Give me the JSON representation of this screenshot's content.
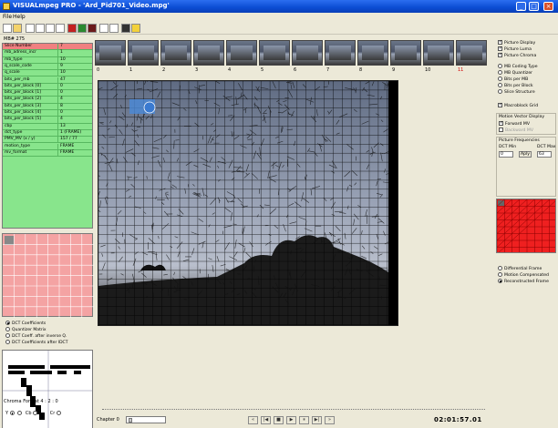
{
  "window": {
    "title": "VISUALmpeg PRO - 'Ard_Pid701_Video.mpg'"
  },
  "menu": {
    "file": "File",
    "help": "Help"
  },
  "toolbar": {
    "icons": [
      "new-icon",
      "open-icon",
      "frame-icon",
      "list-icon",
      "grid-icon",
      "grid2-icon",
      "stop-red-icon",
      "stop-green-icon",
      "stop-dark-icon",
      "zoom-icon",
      "target-icon",
      "monitor-icon",
      "warning-icon"
    ]
  },
  "slice_panel": {
    "mb_label": "MB# 275",
    "rows": [
      {
        "key": "Slice Number",
        "value": "7",
        "highlight": true
      },
      {
        "key": "mb_adress_incr",
        "value": "1"
      },
      {
        "key": "mb_type",
        "value": "10"
      },
      {
        "key": "q_scale_code",
        "value": "9"
      },
      {
        "key": "q_scale",
        "value": "10"
      },
      {
        "key": "bits_per_mb",
        "value": "47"
      },
      {
        "key": "bits_per_block [0]",
        "value": "0"
      },
      {
        "key": "bits_per_block [1]",
        "value": "0"
      },
      {
        "key": "bits_per_block [2]",
        "value": "4"
      },
      {
        "key": "bits_per_block [3]",
        "value": "8"
      },
      {
        "key": "bits_per_block [4]",
        "value": "0"
      },
      {
        "key": "bits_per_block [5]",
        "value": "4"
      },
      {
        "key": "cbp",
        "value": "13"
      },
      {
        "key": "dct_type",
        "value": "1 (FRAME)"
      },
      {
        "key": "PMV_MV (x / y)",
        "value": "157 / 77"
      },
      {
        "key": "motion_type",
        "value": "FRAME"
      },
      {
        "key": "mv_format",
        "value": "FRAME"
      }
    ]
  },
  "dct_view": {
    "options": [
      {
        "label": "DCT Coefficients",
        "selected": true
      },
      {
        "label": "Quantizer Matrix",
        "selected": false
      },
      {
        "label": "DCT Coeff. after inverse Q.",
        "selected": false
      },
      {
        "label": "DCT Coefficients after IDCT",
        "selected": false
      }
    ],
    "chroma_format": "Chroma Format 4 : 2 : 0",
    "y_label": "Y",
    "cb_label": "Cb",
    "cr_label": "Cr"
  },
  "filmstrip": {
    "frames": [
      "0",
      "1",
      "2",
      "3",
      "4",
      "5",
      "6",
      "7",
      "8",
      "9",
      "10",
      "11"
    ],
    "highlight_color": "#d00000"
  },
  "display": {
    "options": [
      {
        "label": "Picture Display",
        "checked": true,
        "type": "check"
      },
      {
        "label": "Picture Luma",
        "checked": true,
        "type": "check"
      },
      {
        "label": "Picture Chroma",
        "checked": true,
        "type": "check"
      },
      {
        "label": "MB Coding Type",
        "checked": false,
        "type": "radio"
      },
      {
        "label": "MB Quantizer",
        "checked": false,
        "type": "radio"
      },
      {
        "label": "Bits per MB",
        "checked": false,
        "type": "radio"
      },
      {
        "label": "Bits per Block",
        "checked": false,
        "type": "radio"
      },
      {
        "label": "Slice Structure",
        "checked": false,
        "type": "radio"
      }
    ],
    "macroblock_grid": "Macroblock Grid",
    "motion_vector_display": "Motion Vector Display",
    "forward_mv": "Forward MV",
    "backward_mv": "Backward MV",
    "picture_frequencies": "Picture Frequencies",
    "dct_min_label": "DCT Min",
    "dct_max_label": "DCT Max",
    "dct_min_value": "0",
    "dct_max_value": "63",
    "apply_label": "Aply",
    "frame_mode": [
      {
        "label": "Differential Frame",
        "selected": false
      },
      {
        "label": "Motion Compensated",
        "selected": false
      },
      {
        "label": "Reconstructed Frame",
        "selected": true
      }
    ]
  },
  "playback": {
    "chapter_label": "Chapter 0",
    "time": "02:01:57.01",
    "buttons": [
      "«",
      "|◀",
      "■",
      "▶",
      "⏸",
      "▶|",
      "»"
    ]
  },
  "colors": {
    "slice_bg": "#88e58c",
    "highlight_row": "#f08080",
    "block_grid": "#f4a3a3",
    "dct_grid": "#ef2020"
  }
}
